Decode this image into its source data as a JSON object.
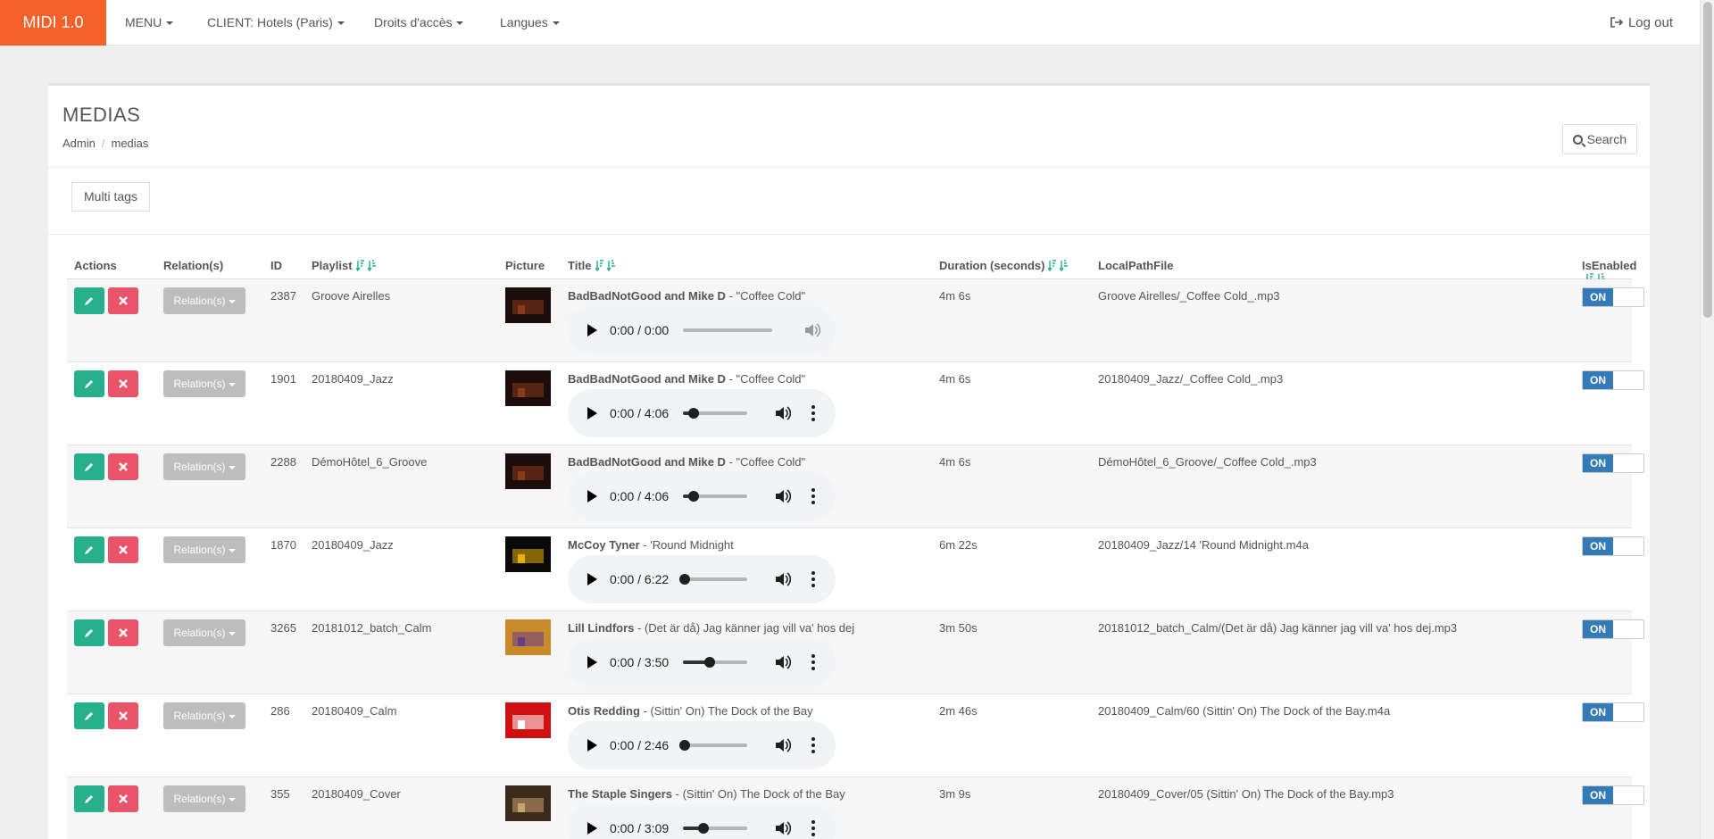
{
  "navbar": {
    "brand": "MIDI 1.0",
    "menu": "MENU",
    "client": "CLIENT: Hotels (Paris)",
    "access": "Droits d'accès",
    "languages": "Langues",
    "logout": "Log out"
  },
  "page": {
    "title": "MEDIAS",
    "breadcrumb": [
      "Admin",
      "medias"
    ],
    "search_label": "Search",
    "multitags_label": "Multi tags"
  },
  "table": {
    "headers": {
      "actions": "Actions",
      "relations": "Relation(s)",
      "id": "ID",
      "playlist": "Playlist",
      "picture": "Picture",
      "title": "Title",
      "duration": "Duration (seconds)",
      "localpath": "LocalPathFile",
      "isenabled": "IsEnabled"
    },
    "relation_button_label": "Relation(s)",
    "toggle_on_label": "ON",
    "rows": [
      {
        "id": "2387",
        "playlist": "Groove Airelles",
        "artist": "BadBadNotGood and Mike D",
        "track": " - \"Coffee Cold\"",
        "duration": "4m 6s",
        "path": "Groove Airelles/_Coffee Cold_.mp3",
        "player_time": "0:00 / 0:00",
        "progress": 0,
        "player_loaded": false,
        "cover_colors": [
          "#1a0d0a",
          "#8a3a1a"
        ]
      },
      {
        "id": "1901",
        "playlist": "20180409_Jazz",
        "artist": "BadBadNotGood and Mike D",
        "track": " - \"Coffee Cold\"",
        "duration": "4m 6s",
        "path": "20180409_Jazz/_Coffee Cold_.mp3",
        "player_time": "0:00 / 4:06",
        "progress": 0.15,
        "player_loaded": true,
        "cover_colors": [
          "#1a0d0a",
          "#8a3a1a"
        ]
      },
      {
        "id": "2288",
        "playlist": "DémoHôtel_6_Groove",
        "artist": "BadBadNotGood and Mike D",
        "track": " - \"Coffee Cold\"",
        "duration": "4m 6s",
        "path": "DémoHôtel_6_Groove/_Coffee Cold_.mp3",
        "player_time": "0:00 / 4:06",
        "progress": 0.15,
        "player_loaded": true,
        "cover_colors": [
          "#1a0d0a",
          "#8a3a1a"
        ]
      },
      {
        "id": "1870",
        "playlist": "20180409_Jazz",
        "artist": "McCoy Tyner",
        "track": " - 'Round Midnight",
        "duration": "6m 22s",
        "path": "20180409_Jazz/14 'Round Midnight.m4a",
        "player_time": "0:00 / 6:22",
        "progress": 0.02,
        "player_loaded": true,
        "cover_colors": [
          "#0a0a0a",
          "#e8b000"
        ]
      },
      {
        "id": "3265",
        "playlist": "20181012_batch_Calm",
        "artist": "Lill Lindfors",
        "track": " - (Det är då) Jag känner jag vill va' hos dej",
        "duration": "3m 50s",
        "path": "20181012_batch_Calm/(Det är då) Jag känner jag vill va' hos dej.mp3",
        "player_time": "0:00 / 3:50",
        "progress": 0.4,
        "player_loaded": true,
        "cover_colors": [
          "#c98a2a",
          "#6a3a8a"
        ]
      },
      {
        "id": "286",
        "playlist": "20180409_Calm",
        "artist": "Otis Redding",
        "track": " - (Sittin' On) The Dock of the Bay",
        "duration": "2m 46s",
        "path": "20180409_Calm/60 (Sittin' On) The Dock of the Bay.m4a",
        "player_time": "0:00 / 2:46",
        "progress": 0.02,
        "player_loaded": true,
        "cover_colors": [
          "#d01010",
          "#ffffff"
        ]
      },
      {
        "id": "355",
        "playlist": "20180409_Cover",
        "artist": "The Staple Singers",
        "track": " - (Sittin' On) The Dock of the Bay",
        "duration": "3m 9s",
        "path": "20180409_Cover/05 (Sittin' On) The Dock of the Bay.mp3",
        "player_time": "0:00 / 3:09",
        "progress": 0.3,
        "player_loaded": true,
        "cover_colors": [
          "#3a2a1a",
          "#c9a070"
        ]
      }
    ]
  }
}
